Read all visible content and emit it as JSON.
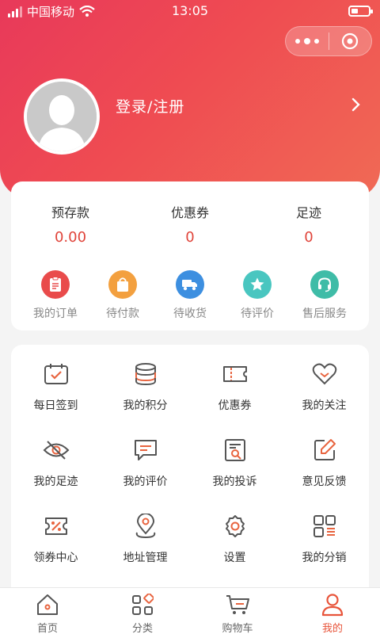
{
  "status_bar": {
    "carrier": "中国移动",
    "time": "13:05"
  },
  "profile": {
    "login_text": "登录/注册"
  },
  "stats": [
    {
      "label": "预存款",
      "value": "0.00"
    },
    {
      "label": "优惠券",
      "value": "0"
    },
    {
      "label": "足迹",
      "value": "0"
    }
  ],
  "orders": [
    {
      "label": "我的订单",
      "icon": "order-list-icon",
      "color": "#e94b4b"
    },
    {
      "label": "待付款",
      "icon": "shopping-bag-icon",
      "color": "#f3a03f"
    },
    {
      "label": "待收货",
      "icon": "delivery-truck-icon",
      "color": "#3d8fe0"
    },
    {
      "label": "待评价",
      "icon": "star-icon",
      "color": "#49c6c0"
    },
    {
      "label": "售后服务",
      "icon": "headset-icon",
      "color": "#3fbca7"
    }
  ],
  "menu": [
    {
      "label": "每日签到",
      "icon": "calendar-check-icon"
    },
    {
      "label": "我的积分",
      "icon": "coins-stack-icon"
    },
    {
      "label": "优惠券",
      "icon": "coupon-icon"
    },
    {
      "label": "我的关注",
      "icon": "heart-icon"
    },
    {
      "label": "我的足迹",
      "icon": "eye-off-icon"
    },
    {
      "label": "我的评价",
      "icon": "comment-icon"
    },
    {
      "label": "我的投诉",
      "icon": "complaint-icon"
    },
    {
      "label": "意见反馈",
      "icon": "edit-icon"
    },
    {
      "label": "领券中心",
      "icon": "discount-ticket-icon"
    },
    {
      "label": "地址管理",
      "icon": "location-pin-icon"
    },
    {
      "label": "设置",
      "icon": "settings-gear-icon"
    },
    {
      "label": "我的分销",
      "icon": "distribution-grid-icon"
    }
  ],
  "tabs": [
    {
      "label": "首页",
      "icon": "home-icon"
    },
    {
      "label": "分类",
      "icon": "category-icon"
    },
    {
      "label": "购物车",
      "icon": "cart-icon"
    },
    {
      "label": "我的",
      "icon": "user-icon",
      "active": true
    }
  ],
  "colors": {
    "accent": "#e8543a",
    "value_red": "#e0443a",
    "icon_accent": "#e8643f"
  }
}
